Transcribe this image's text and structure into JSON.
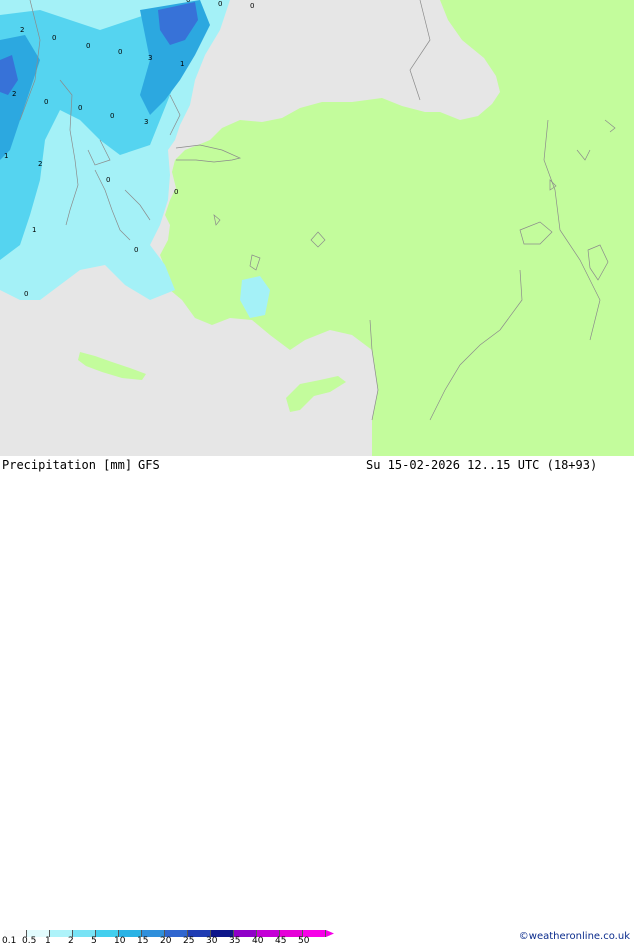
{
  "map": {
    "colors": {
      "sea": "#e6e6e6",
      "land_mask": "#c3fc9c",
      "precip_light": "#a4f1f7",
      "precip_mid": "#55d4f0",
      "precip_strong": "#2ca8e0",
      "precip_heavy": "#3772d8",
      "border": "#8b8b8b"
    },
    "values": [
      "2",
      "0",
      "0",
      "0",
      "3",
      "1",
      "2",
      "0",
      "0",
      "0",
      "3",
      "1",
      "2",
      "0",
      "0",
      "1",
      "0",
      "0",
      "0",
      "0",
      "0"
    ]
  },
  "footer": {
    "title": "Precipitation [mm]",
    "model": "GFS",
    "datetime": "Su 15-02-2026 12..15 UTC (18+93)",
    "credit": "©weatheronline.co.uk"
  },
  "legend": {
    "labels": [
      "0.1",
      "0.5",
      "1",
      "2",
      "5",
      "10",
      "15",
      "20",
      "25",
      "30",
      "35",
      "40",
      "45",
      "50"
    ],
    "colors": [
      "#fbfbfb",
      "#e2fbfd",
      "#aef3fa",
      "#78e3f5",
      "#43cfee",
      "#2ab3e5",
      "#2f8fdb",
      "#3066cf",
      "#1f3cb3",
      "#0e168a",
      "#9000c8",
      "#c400d6",
      "#e600d8",
      "#f700e8"
    ]
  }
}
